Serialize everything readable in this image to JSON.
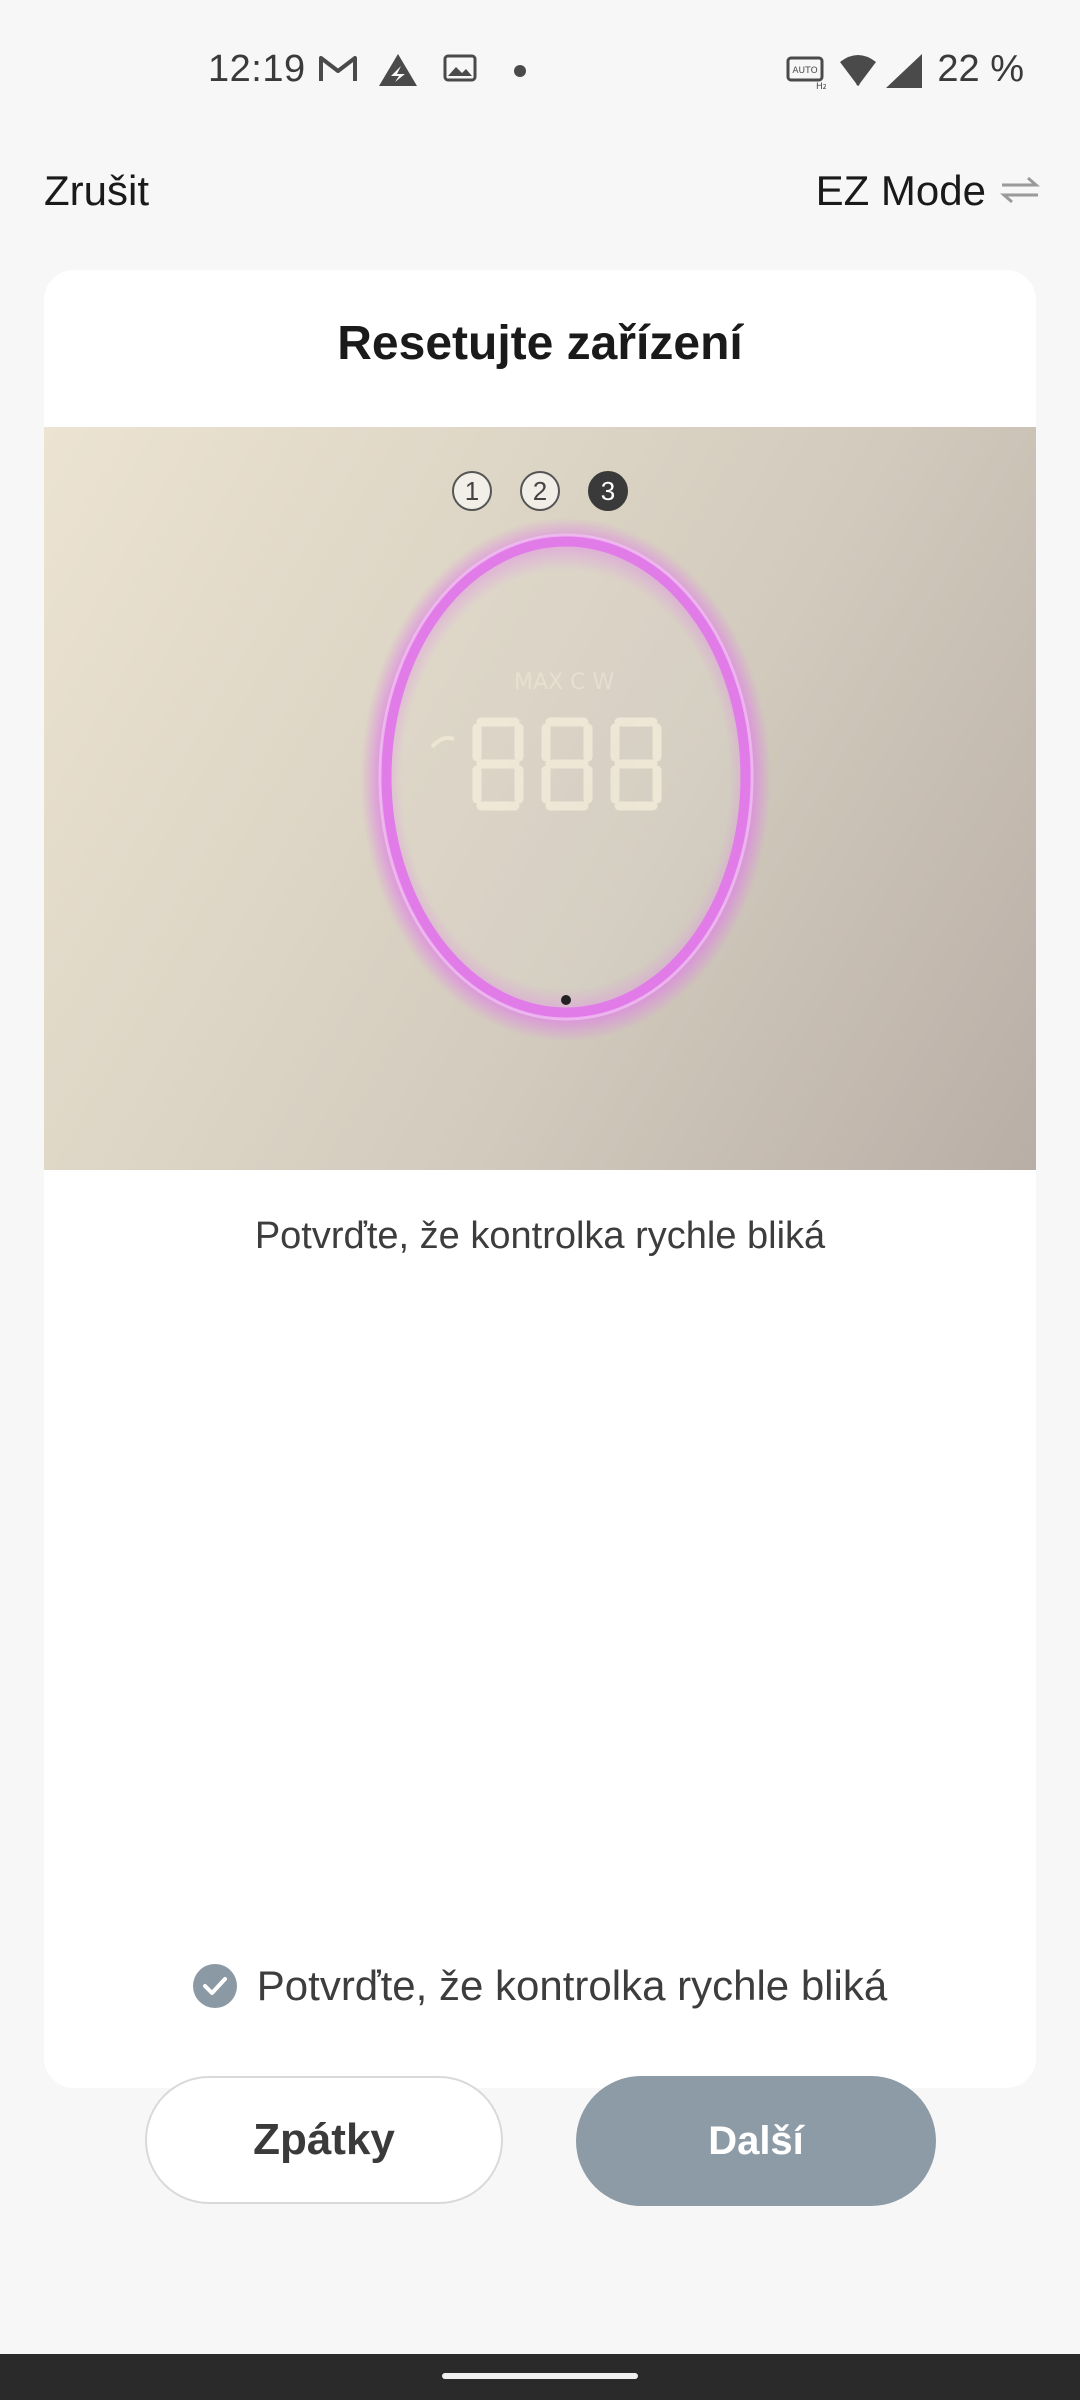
{
  "status_bar": {
    "time": "12:19",
    "battery": "22 %",
    "icons": [
      "gmail-icon",
      "triangle-logo-icon",
      "gallery-icon",
      "dot-icon",
      "auto-hz-icon",
      "wifi-icon",
      "signal-icon"
    ]
  },
  "top_bar": {
    "cancel_label": "Zrušit",
    "mode_label": "EZ Mode"
  },
  "card": {
    "title": "Resetujte zařízení",
    "steps": [
      "1",
      "2",
      "3"
    ],
    "active_step": 3,
    "description": "Potvrďte, že kontrolka rychle bliká",
    "confirm_text": "Potvrďte, že kontrolka rychle bliká",
    "back_button": "Zpátky",
    "next_button": "Další"
  },
  "colors": {
    "accent_gray": "#8d9ba7",
    "ring_pink": "#e07be8"
  }
}
